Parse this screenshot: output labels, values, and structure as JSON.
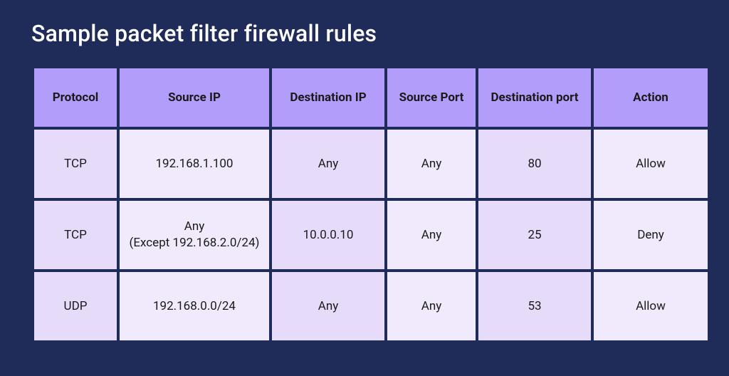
{
  "title": "Sample packet filter firewall rules",
  "chart_data": {
    "type": "table",
    "title": "Sample packet filter firewall rules",
    "columns": [
      "Protocol",
      "Source IP",
      "Destination IP",
      "Source Port",
      "Destination port",
      "Action"
    ],
    "rows": [
      {
        "protocol": "TCP",
        "source_ip": "192.168.1.100",
        "destination_ip": "Any",
        "source_port": "Any",
        "destination_port": "80",
        "action": "Allow"
      },
      {
        "protocol": "TCP",
        "source_ip": "Any\n(Except 192.168.2.0/24)",
        "destination_ip": "10.0.0.10",
        "source_port": "Any",
        "destination_port": "25",
        "action": "Deny"
      },
      {
        "protocol": "UDP",
        "source_ip": "192.168.0.0/24",
        "destination_ip": "Any",
        "source_port": "Any",
        "destination_port": "53",
        "action": "Allow"
      }
    ]
  }
}
